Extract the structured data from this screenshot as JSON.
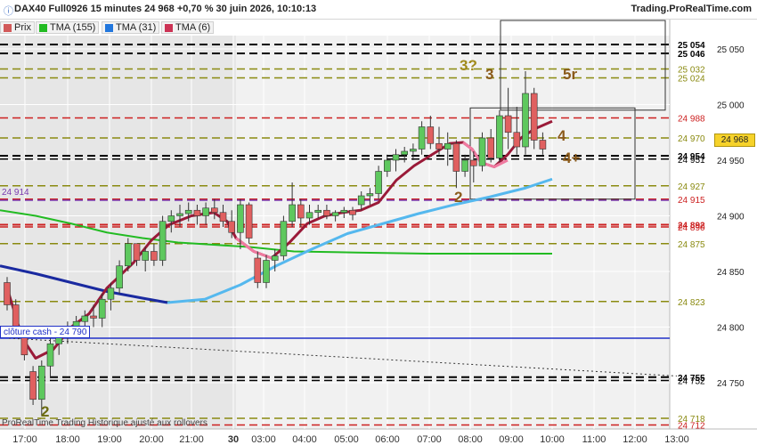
{
  "header": {
    "title": "DAX40 Full0926 15 minutes 24 968 +0,70 % 30 juin 2026, 10:10:13",
    "site": "Trading.ProRealTime.com"
  },
  "legend": [
    {
      "label": "Prix",
      "color": "#d25a5a"
    },
    {
      "label": "TMA (155)",
      "color": "#22bb22"
    },
    {
      "label": "TMA (31)",
      "color": "#2277dd"
    },
    {
      "label": "TMA (6)",
      "color": "#cc3355"
    }
  ],
  "footer_note": "ProRealTime Trading  Historique ajusté aux rollovers",
  "cash_label": "clôture cash -  24 790",
  "left_label_914": "24 914",
  "last_price_label": "24 968",
  "wave_labels": [
    {
      "text": "3?",
      "color": "#a08a1a"
    },
    {
      "text": "3",
      "color": "#8a5a1a"
    },
    {
      "text": "5r",
      "color": "#8a5a1a"
    },
    {
      "text": "4",
      "color": "#8a5a1a"
    },
    {
      "text": "4+",
      "color": "#8a5a1a"
    },
    {
      "text": "2",
      "color": "#8a5a1a"
    },
    {
      "text": "2",
      "color": "#6b6b10"
    }
  ],
  "chart_data": {
    "type": "candlestick",
    "title": "DAX40 Full0926 15 minutes",
    "y_axis": {
      "min": 24700,
      "max": 25070,
      "ticks": [
        24750,
        24800,
        24850,
        24900,
        24950,
        25000,
        25050
      ]
    },
    "x_labels": [
      "17:00",
      "18:00",
      "19:00",
      "20:00",
      "21:00",
      "30",
      "03:00",
      "04:00",
      "05:00",
      "06:00",
      "07:00",
      "08:00",
      "09:00",
      "10:00",
      "11:00",
      "12:00",
      "13:00"
    ],
    "levels": [
      {
        "value": 25054,
        "label": "25 054",
        "color": "#000000",
        "style": "dash",
        "bold": true
      },
      {
        "value": 25046,
        "label": "25 046",
        "color": "#000000",
        "style": "dash",
        "bold": true
      },
      {
        "value": 25032,
        "label": "25 032",
        "color": "#8a8a10",
        "style": "dash"
      },
      {
        "value": 25024,
        "label": "25 024",
        "color": "#8a8a10",
        "style": "dash"
      },
      {
        "value": 24988,
        "label": "24 988",
        "color": "#cc2020",
        "style": "dash"
      },
      {
        "value": 24970,
        "label": "24 970",
        "color": "#8a8a10",
        "style": "dash"
      },
      {
        "value": 24954,
        "label": "24 954",
        "color": "#000000",
        "style": "dash",
        "bold": true
      },
      {
        "value": 24951,
        "label": "24 951",
        "color": "#000000",
        "style": "dash"
      },
      {
        "value": 24927,
        "label": "24 927",
        "color": "#8a8a10",
        "style": "dash"
      },
      {
        "value": 24915,
        "label": "24 915",
        "color": "#cc2020",
        "style": "dash"
      },
      {
        "value": 24914,
        "label": "24 914",
        "color": "#7a3ab0",
        "style": "dash"
      },
      {
        "value": 24892,
        "label": "24 892",
        "color": "#cc2020",
        "style": "dash",
        "bold": true
      },
      {
        "value": 24890,
        "label": "24 890",
        "color": "#cc2020",
        "style": "dash"
      },
      {
        "value": 24875,
        "label": "24 875",
        "color": "#8a8a10",
        "style": "dash"
      },
      {
        "value": 24823,
        "label": "24 823",
        "color": "#8a8a10",
        "style": "dash"
      },
      {
        "value": 24790,
        "label": "24 790",
        "color": "#2030c8",
        "style": "solid"
      },
      {
        "value": 24755,
        "label": "24 755",
        "color": "#000000",
        "style": "dash",
        "bold": true
      },
      {
        "value": 24752,
        "label": "24 752",
        "color": "#000000",
        "style": "dash"
      },
      {
        "value": 24718,
        "label": "24 718",
        "color": "#8a8a10",
        "style": "dash"
      },
      {
        "value": 24712,
        "label": "24 712",
        "color": "#cc2020",
        "style": "dash"
      }
    ],
    "candles": [
      [
        24840,
        24845,
        24815,
        24820
      ],
      [
        24820,
        24825,
        24790,
        24795
      ],
      [
        24795,
        24800,
        24770,
        24775
      ],
      [
        24760,
        24765,
        24730,
        24735
      ],
      [
        24735,
        24770,
        24720,
        24765
      ],
      [
        24765,
        24790,
        24755,
        24785
      ],
      [
        24785,
        24800,
        24775,
        24795
      ],
      [
        24795,
        24805,
        24785,
        24800
      ],
      [
        24800,
        24810,
        24790,
        24805
      ],
      [
        24805,
        24815,
        24800,
        24810
      ],
      [
        24810,
        24820,
        24800,
        24808
      ],
      [
        24808,
        24830,
        24800,
        24825
      ],
      [
        24825,
        24840,
        24815,
        24835
      ],
      [
        24835,
        24860,
        24830,
        24855
      ],
      [
        24855,
        24880,
        24850,
        24875
      ],
      [
        24875,
        24870,
        24855,
        24860
      ],
      [
        24860,
        24872,
        24850,
        24868
      ],
      [
        24868,
        24875,
        24855,
        24860
      ],
      [
        24860,
        24900,
        24855,
        24895
      ],
      [
        24895,
        24905,
        24885,
        24900
      ],
      [
        24900,
        24910,
        24890,
        24902
      ],
      [
        24902,
        24912,
        24895,
        24905
      ],
      [
        24905,
        24910,
        24892,
        24900
      ],
      [
        24900,
        24912,
        24892,
        24907
      ],
      [
        24907,
        24915,
        24897,
        24903
      ],
      [
        24903,
        24910,
        24890,
        24895
      ],
      [
        24895,
        24905,
        24880,
        24885
      ],
      [
        24885,
        24915,
        24870,
        24910
      ],
      [
        24910,
        24912,
        24875,
        24880
      ],
      [
        24862,
        24868,
        24835,
        24840
      ],
      [
        24840,
        24865,
        24835,
        24860
      ],
      [
        24860,
        24870,
        24850,
        24864
      ],
      [
        24864,
        24900,
        24860,
        24895
      ],
      [
        24895,
        24930,
        24890,
        24910
      ],
      [
        24910,
        24915,
        24890,
        24898
      ],
      [
        24898,
        24910,
        24892,
        24903
      ],
      [
        24903,
        24910,
        24898,
        24905
      ],
      [
        24905,
        24910,
        24897,
        24900
      ],
      [
        24900,
        24905,
        24895,
        24903
      ],
      [
        24903,
        24908,
        24898,
        24905
      ],
      [
        24905,
        24908,
        24896,
        24901
      ],
      [
        24910,
        24922,
        24905,
        24918
      ],
      [
        24918,
        24925,
        24910,
        24920
      ],
      [
        24920,
        24945,
        24915,
        24940
      ],
      [
        24940,
        24955,
        24935,
        24950
      ],
      [
        24950,
        24960,
        24940,
        24955
      ],
      [
        24955,
        24962,
        24948,
        24958
      ],
      [
        24958,
        24965,
        24950,
        24960
      ],
      [
        24960,
        24985,
        24955,
        24980
      ],
      [
        24980,
        24990,
        24960,
        24965
      ],
      [
        24965,
        24980,
        24955,
        24960
      ],
      [
        24960,
        24975,
        24945,
        24965
      ],
      [
        24965,
        24968,
        24925,
        24940
      ],
      [
        24940,
        24955,
        24935,
        24950
      ],
      [
        24950,
        24958,
        24930,
        24945
      ],
      [
        24945,
        24975,
        24940,
        24970
      ],
      [
        24970,
        24978,
        24948,
        24952
      ],
      [
        24952,
        24995,
        24948,
        24990
      ],
      [
        24990,
        25015,
        24960,
        24975
      ],
      [
        24975,
        24998,
        24955,
        24962
      ],
      [
        24962,
        25030,
        24955,
        25010
      ],
      [
        25010,
        25015,
        24960,
        24968
      ],
      [
        24968,
        24975,
        24955,
        24960
      ]
    ]
  }
}
